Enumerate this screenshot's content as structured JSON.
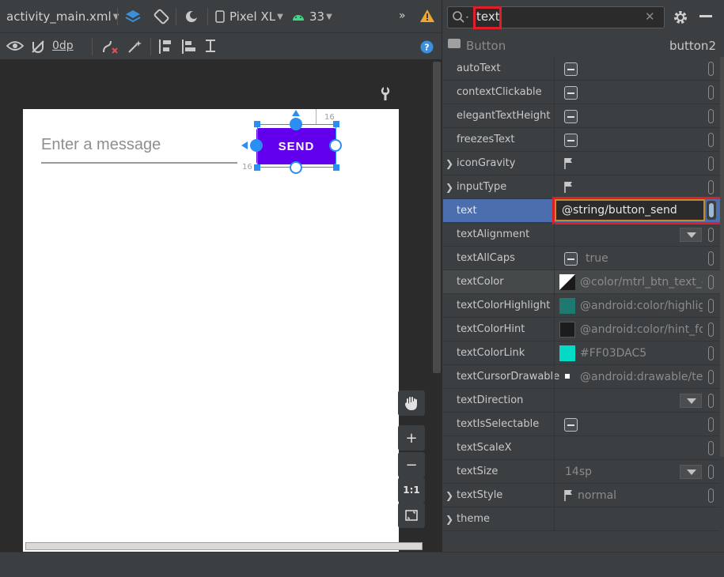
{
  "toolbar": {
    "file_name": "activity_main.xml",
    "device": "Pixel XL",
    "api_level": "33",
    "default_margin": "0dp"
  },
  "preview": {
    "edit_text_hint": "Enter a message",
    "button_label": "SEND",
    "constraint_label_top": "16",
    "constraint_label_left": "16"
  },
  "zoom": {
    "reset_label": "1:1"
  },
  "attributes": {
    "search_query": "text",
    "component_type": "Button",
    "component_id": "button2",
    "rows": [
      {
        "name": "autoText",
        "value": ""
      },
      {
        "name": "contextClickable",
        "value": ""
      },
      {
        "name": "elegantTextHeight",
        "value": ""
      },
      {
        "name": "freezesText",
        "value": ""
      },
      {
        "name": "iconGravity",
        "value": ""
      },
      {
        "name": "inputType",
        "value": ""
      },
      {
        "name": "text",
        "value": "@string/button_send"
      },
      {
        "name": "textAlignment",
        "value": ""
      },
      {
        "name": "textAllCaps",
        "value": "true"
      },
      {
        "name": "textColor",
        "value": "@color/mtrl_btn_text_c"
      },
      {
        "name": "textColorHighlight",
        "value": "@android:color/highlig"
      },
      {
        "name": "textColorHint",
        "value": "@android:color/hint_fo"
      },
      {
        "name": "textColorLink",
        "value": "#FF03DAC5"
      },
      {
        "name": "textCursorDrawable",
        "value": "@android:drawable/tex"
      },
      {
        "name": "textDirection",
        "value": ""
      },
      {
        "name": "textIsSelectable",
        "value": ""
      },
      {
        "name": "textScaleX",
        "value": ""
      },
      {
        "name": "textSize",
        "value": "14sp"
      },
      {
        "name": "textStyle",
        "value": "normal"
      },
      {
        "name": "theme",
        "value": ""
      }
    ]
  },
  "colors": {
    "accent": "#6200ee",
    "selection": "#2b8ef2",
    "highlight_row": "#4b6eaf",
    "red_annotation": "#e01e2a",
    "color_highlight_swatch": "#1e7a70",
    "color_link_swatch": "#03DAC5"
  }
}
